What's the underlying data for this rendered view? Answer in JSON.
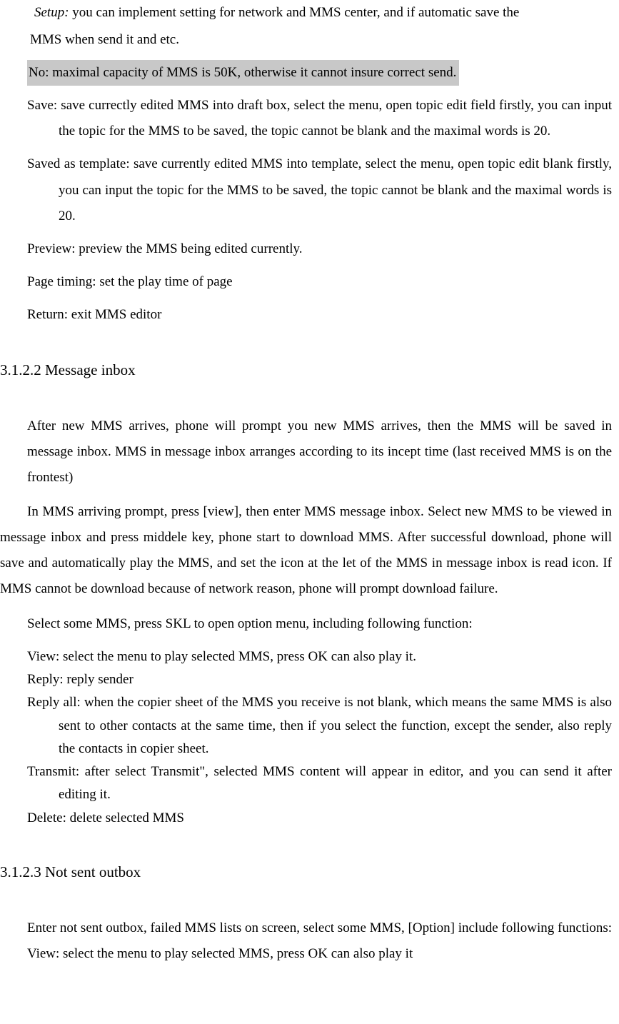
{
  "setup": {
    "label": "Setup:",
    "text1": " you can implement setting for network and MMS center, and if automatic save the",
    "text2": "MMS when send it and etc."
  },
  "highlighted_note": "No: maximal capacity of MMS is 50K, otherwise it cannot insure correct send.",
  "save_item": "Save: save currectly edited MMS into draft box, select the menu, open topic edit field firstly, you can input the topic for the MMS to be saved, the topic cannot be blank and the maximal words is 20.",
  "saved_template_item": "Saved as template: save currently edited MMS into template, select the menu, open topic edit blank firstly, you can input the topic for the MMS to be saved, the topic cannot be blank and the maximal words is 20.",
  "preview_item": "Preview: preview the MMS being edited currently.",
  "page_timing_item": "Page timing: set the play time of page",
  "return_item": "Return: exit MMS editor",
  "heading_inbox": "3.1.2.2 Message inbox",
  "inbox_para1": "After new MMS arrives, phone will prompt you new MMS arrives, then the MMS will be saved in message inbox. MMS in message inbox arranges according to its incept time (last received MMS is on the frontest)",
  "inbox_para2": "In MMS arriving prompt, press [view], then enter MMS message inbox. Select new MMS to be viewed in message inbox and press middele key, phone start to download MMS. After successful download, phone will save and automatically play the MMS, and set the icon at the let of the MMS in message inbox is read icon. If MMS cannot be download because of network reason, phone will prompt download failure.",
  "inbox_para3": "Select some MMS, press SKL to open option menu, including following function:",
  "view_item": "View: select the menu to play selected MMS, press OK can also play it.",
  "reply_item": "Reply: reply sender",
  "reply_all_item": "Reply all: when the copier sheet of the MMS you receive is not blank, which means the same MMS is also sent to other contacts at the same time, then if you select the function, except the sender, also reply the contacts in copier sheet.",
  "transmit_item": "Transmit: after select Transmit\", selected MMS content will appear in editor, and you can send it after editing it.",
  "delete_item": "Delete: delete selected MMS",
  "heading_outbox": "3.1.2.3 Not sent outbox",
  "outbox_para1": "Enter not sent outbox, failed MMS lists on screen, select some MMS, [Option] include following functions:",
  "outbox_view_item": "View: select the menu to play selected MMS, press OK can also play it"
}
